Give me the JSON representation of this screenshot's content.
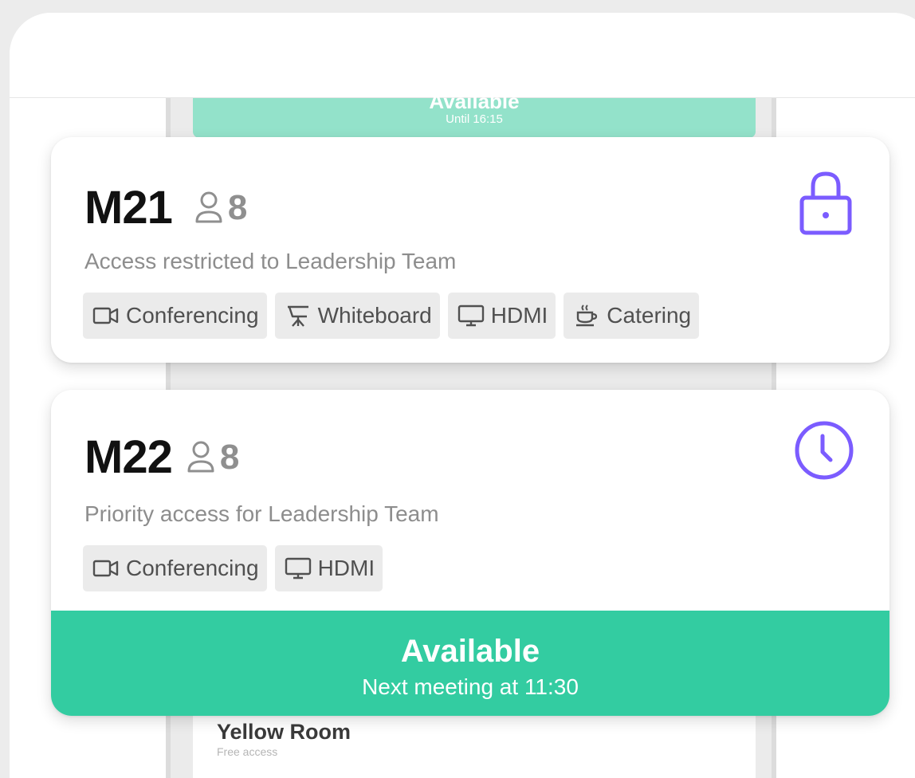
{
  "background": {
    "status_title": "Available",
    "status_sub": "Until 16:15",
    "next_room_name": "Yellow Room",
    "next_room_access": "Free access"
  },
  "cards": [
    {
      "name": "M21",
      "capacity": "8",
      "description": "Access restricted to Leadership Team",
      "status_icon": "lock-icon",
      "amenities": [
        {
          "label": "Conferencing",
          "icon": "video-camera-icon"
        },
        {
          "label": "Whiteboard",
          "icon": "whiteboard-icon"
        },
        {
          "label": "HDMI",
          "icon": "monitor-icon"
        },
        {
          "label": "Catering",
          "icon": "coffee-cup-icon"
        }
      ]
    },
    {
      "name": "M22",
      "capacity": "8",
      "description": "Priority access for Leadership Team",
      "status_icon": "clock-icon",
      "amenities": [
        {
          "label": "Conferencing",
          "icon": "video-camera-icon"
        },
        {
          "label": "HDMI",
          "icon": "monitor-icon"
        }
      ],
      "availability": {
        "title": "Available",
        "subtitle": "Next meeting at 11:30"
      }
    }
  ],
  "colors": {
    "accent_purple": "#7b5cff",
    "available_green": "#33cca1",
    "available_green_dim": "#93e2ca"
  }
}
